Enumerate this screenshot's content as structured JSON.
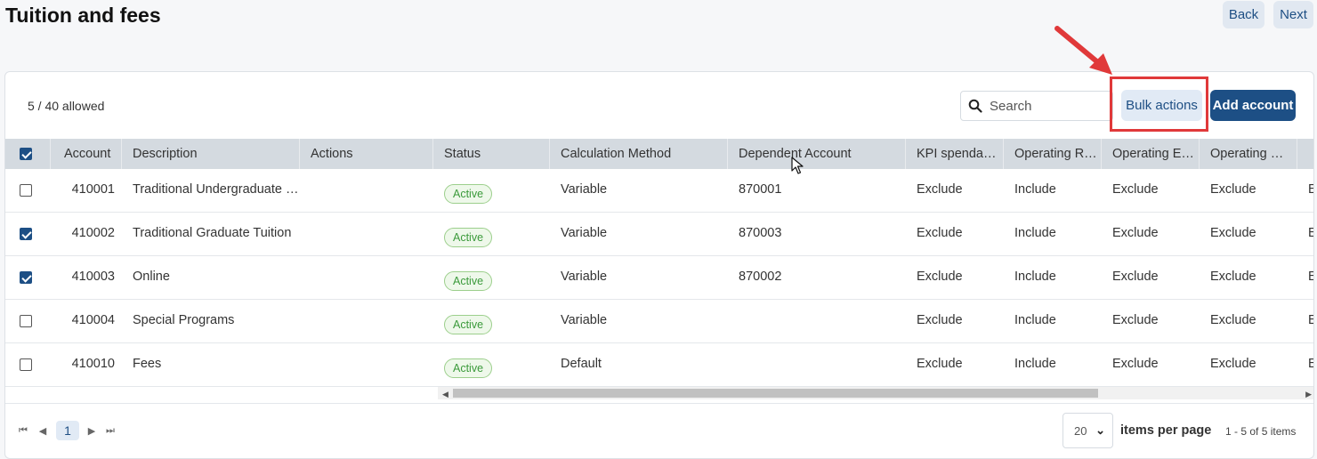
{
  "page": {
    "title": "Tuition and fees"
  },
  "nav": {
    "back_label": "Back",
    "next_label": "Next"
  },
  "toolbar": {
    "allowed_text": "5 / 40 allowed",
    "search_placeholder": "Search",
    "bulk_actions_label": "Bulk actions",
    "add_account_label": "Add account"
  },
  "table": {
    "columns": {
      "account": "Account",
      "description": "Description",
      "actions": "Actions",
      "status": "Status",
      "calculation_method": "Calculation Method",
      "dependent_account": "Dependent Account",
      "kpi": "KPI spenda…",
      "operating_r": "Operating R…",
      "operating_e": "Operating E…",
      "operating_3": "Operating …"
    },
    "header_checked": true,
    "rows": [
      {
        "checked": false,
        "account": "410001",
        "description": "Traditional Undergraduate …",
        "status": "Active",
        "calc": "Variable",
        "dependent": "870001",
        "kpi": "Exclude",
        "op_r": "Include",
        "op_e": "Exclude",
        "op_3": "Exclude",
        "extra": "E"
      },
      {
        "checked": true,
        "account": "410002",
        "description": "Traditional Graduate Tuition",
        "status": "Active",
        "calc": "Variable",
        "dependent": "870003",
        "kpi": "Exclude",
        "op_r": "Include",
        "op_e": "Exclude",
        "op_3": "Exclude",
        "extra": "E"
      },
      {
        "checked": true,
        "account": "410003",
        "description": "Online",
        "status": "Active",
        "calc": "Variable",
        "dependent": "870002",
        "kpi": "Exclude",
        "op_r": "Include",
        "op_e": "Exclude",
        "op_3": "Exclude",
        "extra": "E"
      },
      {
        "checked": false,
        "account": "410004",
        "description": "Special Programs",
        "status": "Active",
        "calc": "Variable",
        "dependent": "",
        "kpi": "Exclude",
        "op_r": "Include",
        "op_e": "Exclude",
        "op_3": "Exclude",
        "extra": "E"
      },
      {
        "checked": false,
        "account": "410010",
        "description": "Fees",
        "status": "Active",
        "calc": "Default",
        "dependent": "",
        "kpi": "Exclude",
        "op_r": "Include",
        "op_e": "Exclude",
        "op_3": "Exclude",
        "extra": "E"
      }
    ]
  },
  "pagination": {
    "current_page": "1",
    "page_size": "20",
    "items_per_page_label": "items per page",
    "range_text": "1 - 5 of 5 items"
  },
  "colors": {
    "primary": "#1d4f85",
    "highlight_box": "#e0393a",
    "active_badge": "#3b9a3b"
  }
}
